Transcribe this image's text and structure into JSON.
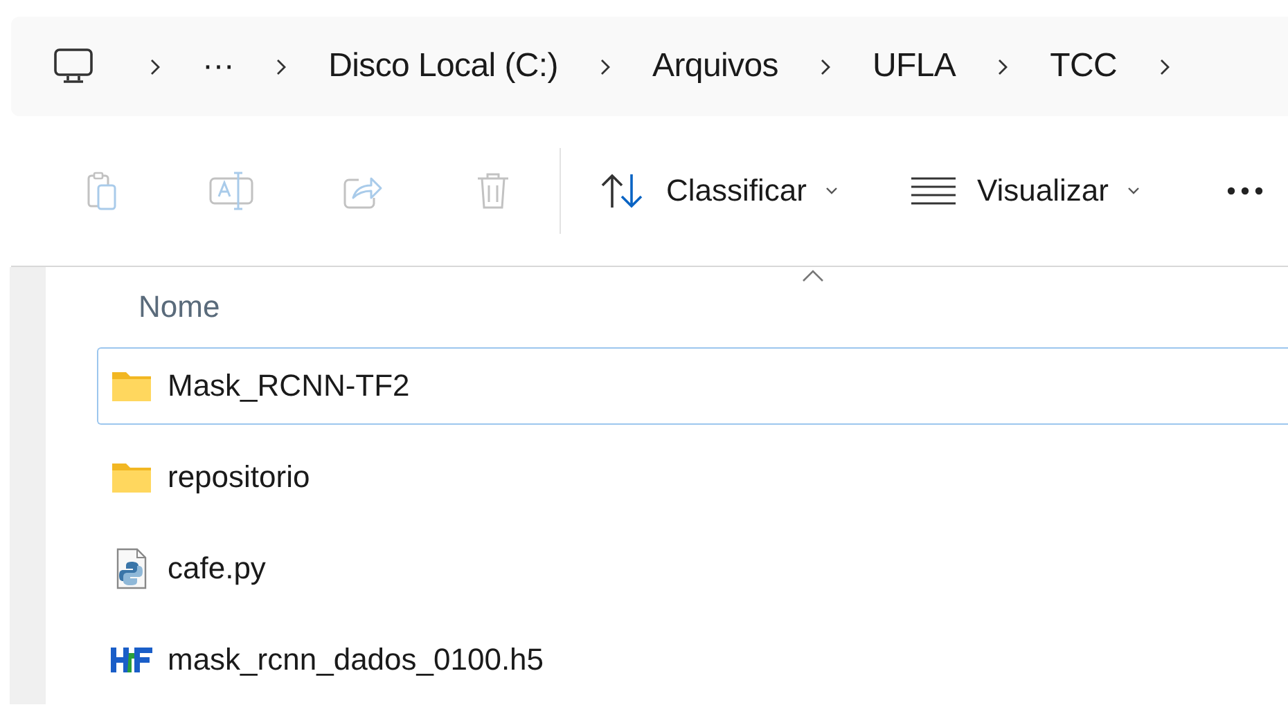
{
  "breadcrumb": {
    "items": [
      "···",
      "Disco Local (C:)",
      "Arquivos",
      "UFLA",
      "TCC"
    ]
  },
  "toolbar": {
    "actions": [
      {
        "kind": "paste",
        "disabled": true
      },
      {
        "kind": "rename",
        "disabled": true
      },
      {
        "kind": "share",
        "disabled": true
      },
      {
        "kind": "delete",
        "disabled": true
      }
    ],
    "menus": [
      {
        "kind": "sort",
        "label": "Classificar"
      },
      {
        "kind": "view",
        "label": "Visualizar"
      }
    ]
  },
  "table": {
    "columns": [
      {
        "label": "Nome",
        "sorted": true
      }
    ],
    "rows": [
      {
        "name": "Mask_RCNN-TF2",
        "kind": "folder",
        "selected": true
      },
      {
        "name": "repositorio",
        "kind": "folder",
        "selected": false
      },
      {
        "name": "cafe.py",
        "kind": "python",
        "selected": false
      },
      {
        "name": "mask_rcnn_dados_0100.h5",
        "kind": "hdf5",
        "selected": false
      }
    ]
  }
}
